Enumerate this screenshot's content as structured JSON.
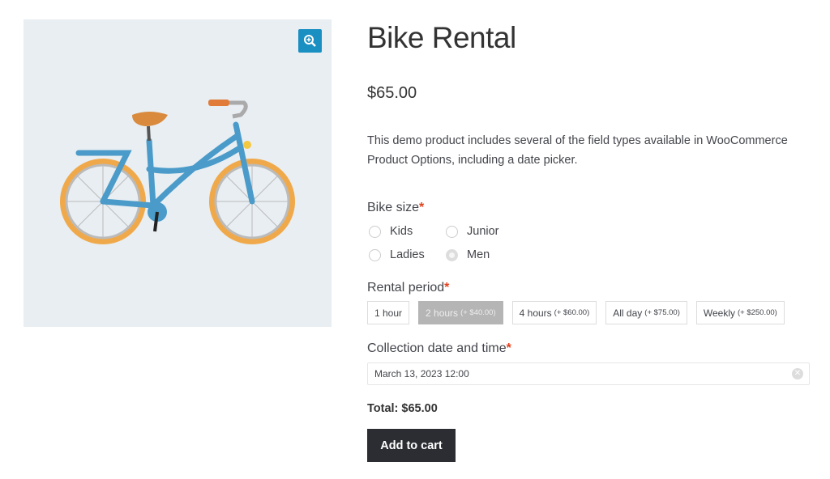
{
  "product": {
    "title": "Bike Rental",
    "price": "$65.00",
    "description": "This demo product includes several of the field types available in WooCommerce Product Options, including a date picker.",
    "image_alt": "bicycle illustration"
  },
  "bike_size": {
    "label": "Bike size",
    "required_mark": "*",
    "options": [
      {
        "label": "Kids",
        "selected": false
      },
      {
        "label": "Junior",
        "selected": false
      },
      {
        "label": "Ladies",
        "selected": false
      },
      {
        "label": "Men",
        "selected": true
      }
    ]
  },
  "rental_period": {
    "label": "Rental period",
    "required_mark": "*",
    "options": [
      {
        "label": "1 hour",
        "price": "",
        "selected": false
      },
      {
        "label": "2 hours",
        "price": "(+ $40.00)",
        "selected": true
      },
      {
        "label": "4 hours",
        "price": "(+ $60.00)",
        "selected": false
      },
      {
        "label": "All day",
        "price": "(+ $75.00)",
        "selected": false
      },
      {
        "label": "Weekly",
        "price": "(+ $250.00)",
        "selected": false
      }
    ]
  },
  "collection": {
    "label": "Collection date and time",
    "required_mark": "*",
    "value": "March 13, 2023 12:00"
  },
  "total": "Total: $65.00",
  "add_to_cart": "Add to cart",
  "icons": {
    "zoom": "zoom-in-icon",
    "clear": "clear-circle-icon"
  },
  "colors": {
    "accent": "#1a8fc2",
    "button": "#2c2d33",
    "required": "#e2401c"
  }
}
